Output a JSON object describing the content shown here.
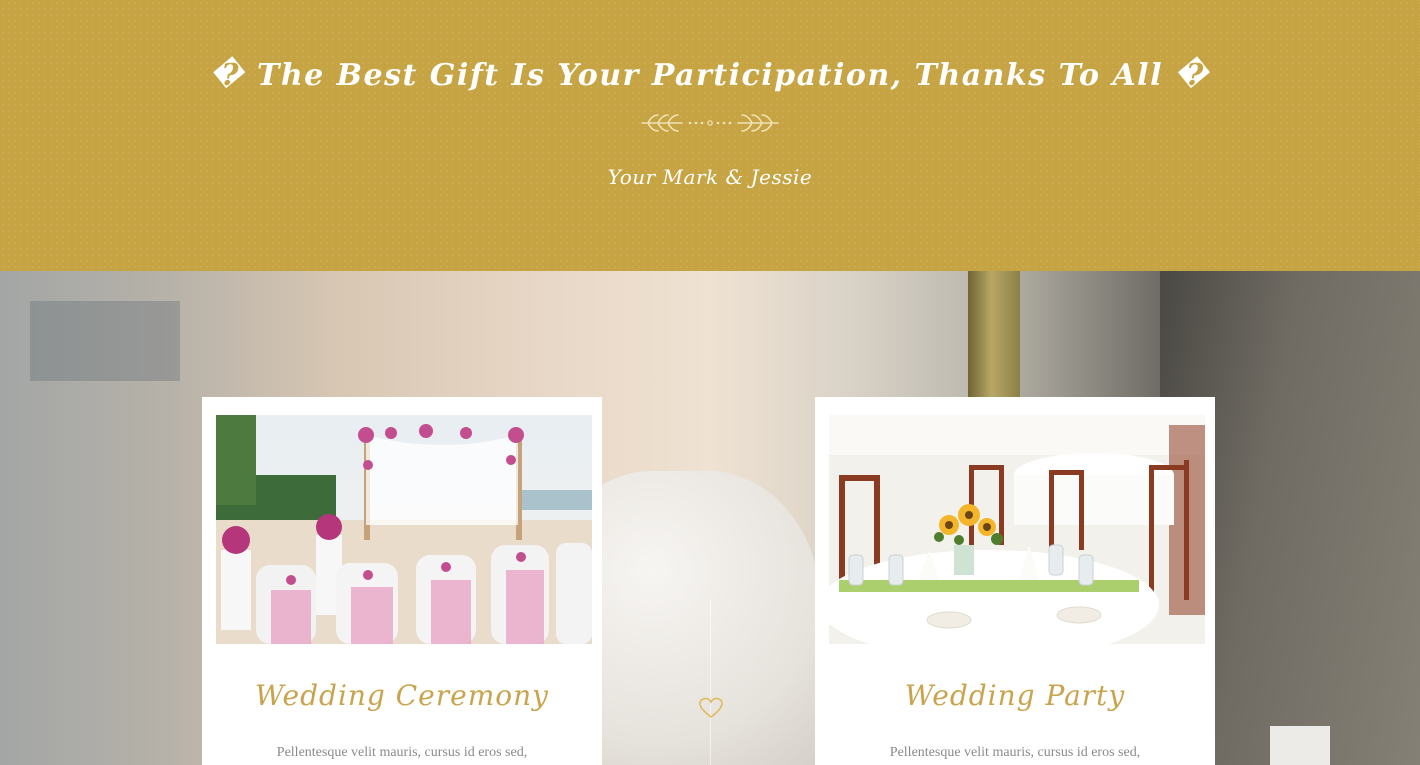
{
  "banner": {
    "title": "� The Best Gift Is Your Participation, Thanks To All �",
    "signature": "Your Mark & Jessie",
    "background_color": "#c7a443",
    "divider_icon": "laurel-divider-icon"
  },
  "events": [
    {
      "title": "Wedding Ceremony",
      "description": "Pellentesque velit mauris, cursus id eros sed,",
      "image": "beach-ceremony-photo"
    },
    {
      "title": "Wedding Party",
      "description": "Pellentesque velit mauris, cursus id eros sed,",
      "image": "reception-tables-photo"
    }
  ],
  "center_icon": "heart-icon",
  "colors": {
    "accent": "#c9a44c",
    "text_muted": "#8a8a8a",
    "card_bg": "#ffffff"
  }
}
